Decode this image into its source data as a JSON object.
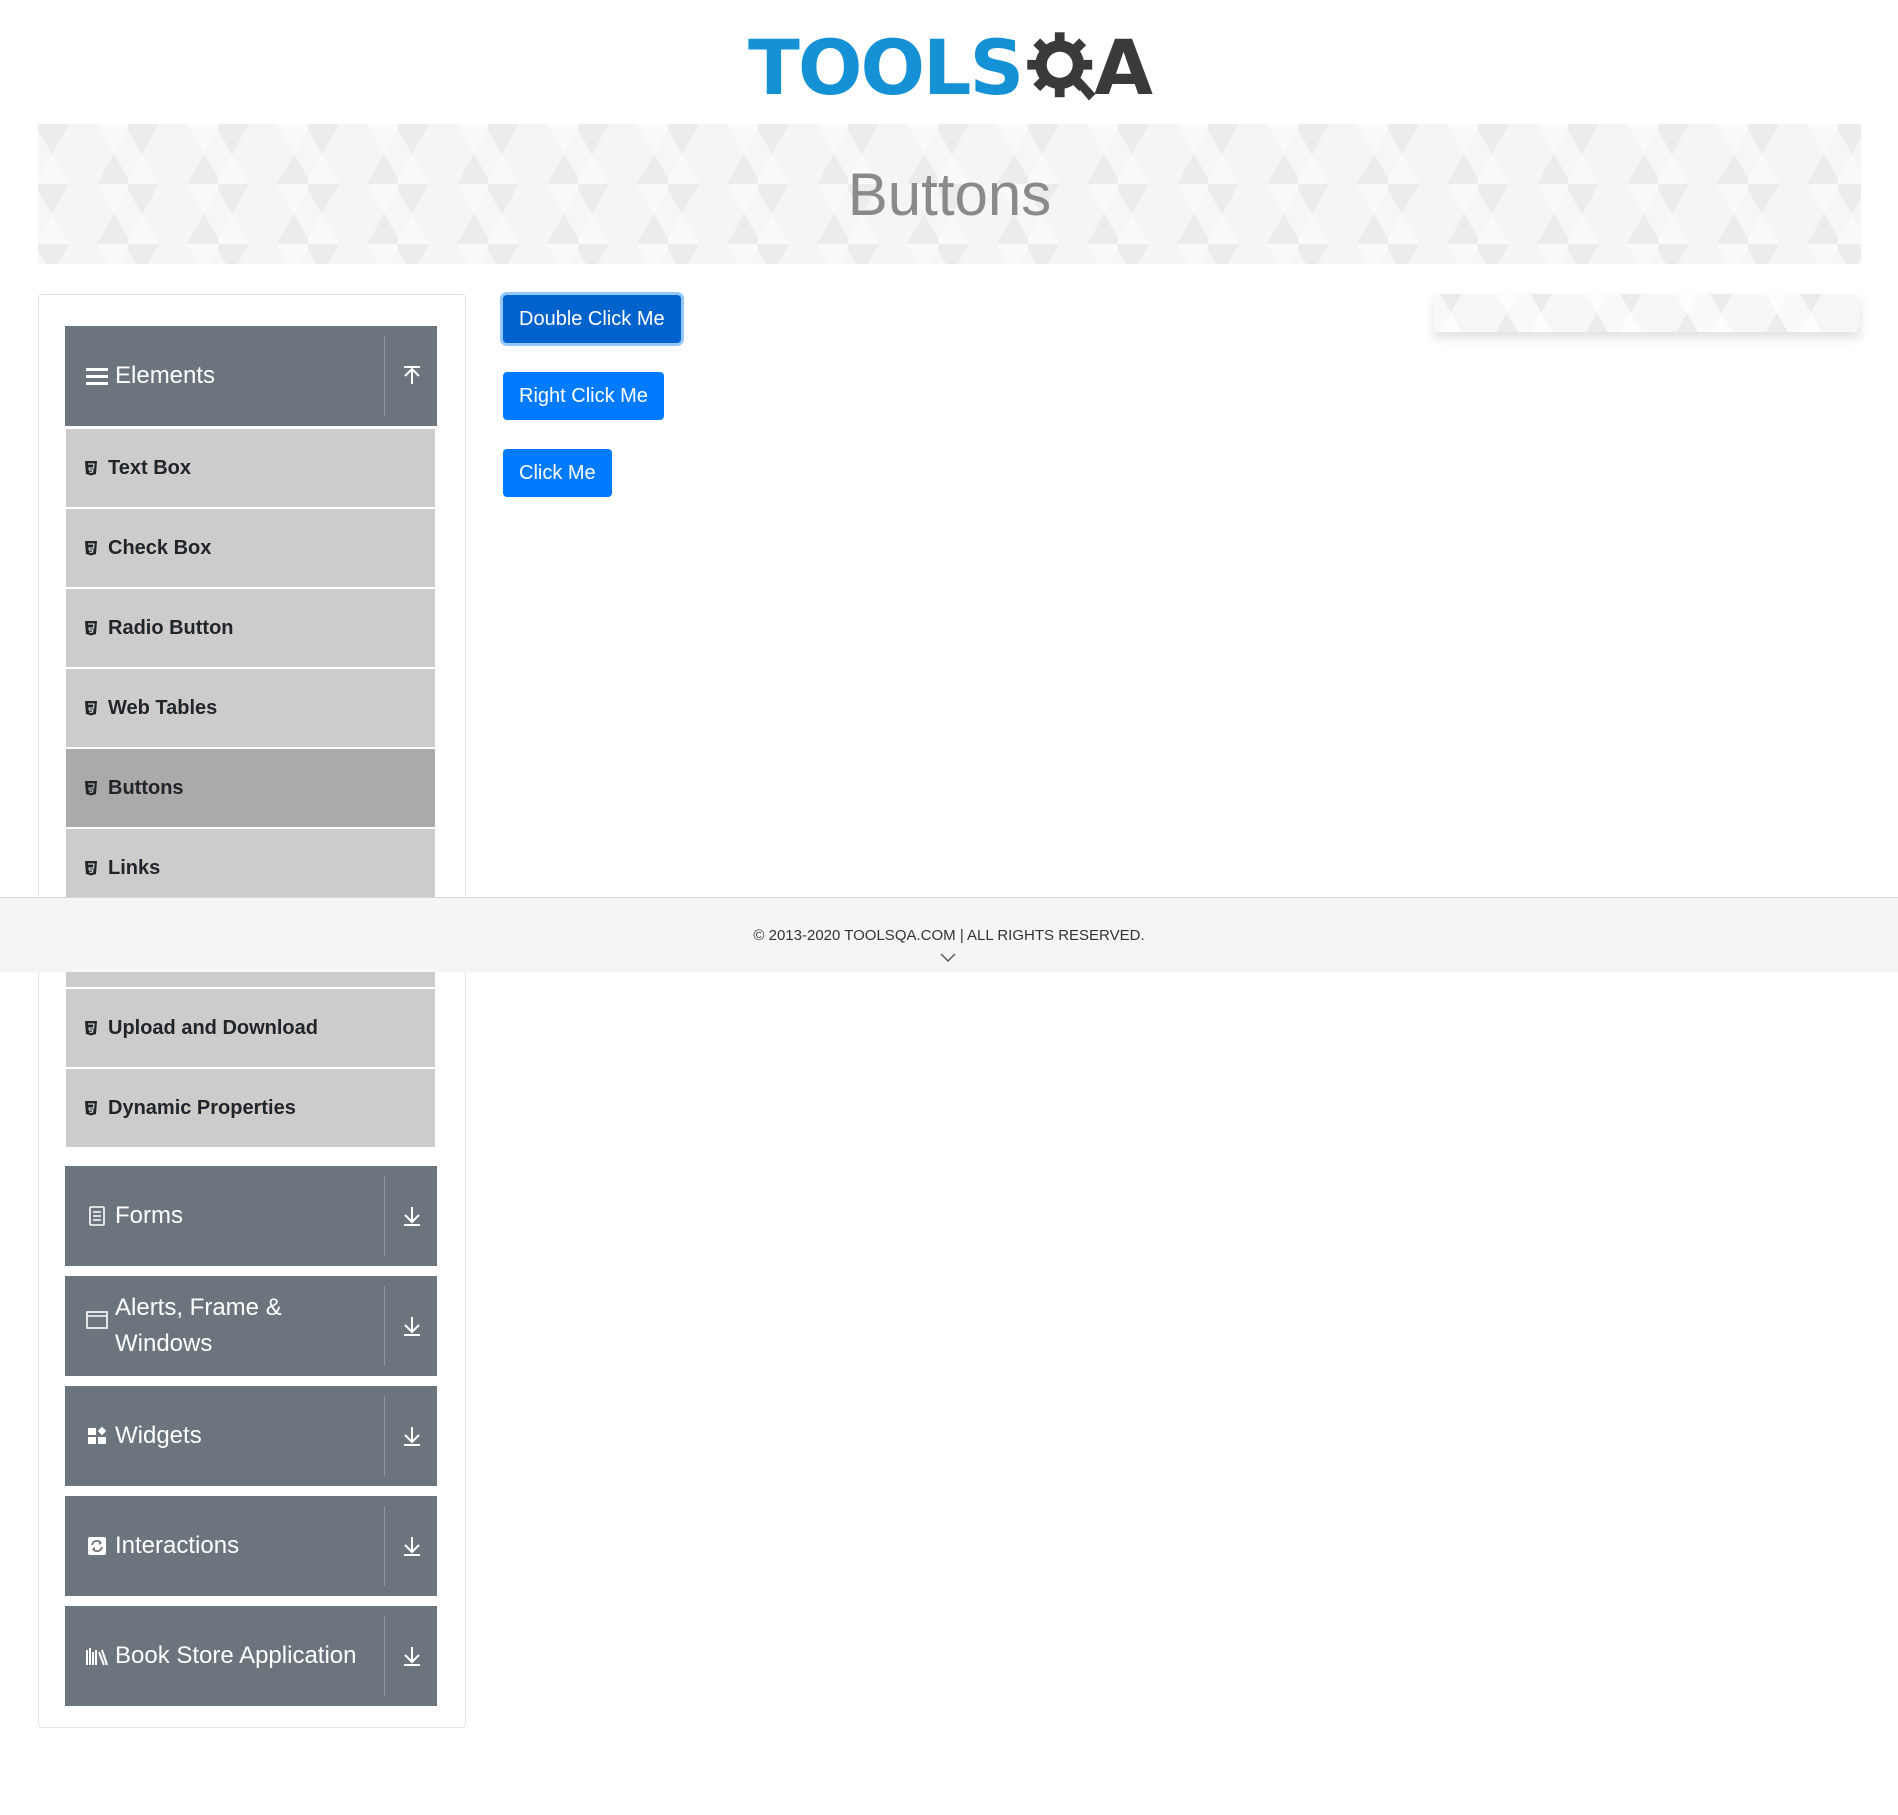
{
  "logo": {
    "text_part": "TOOLS",
    "gear_letter": "Q",
    "last_letter": "A"
  },
  "banner": {
    "title": "Buttons"
  },
  "sidebar": {
    "groups": [
      {
        "label": "Elements",
        "icon": "hamburger-icon",
        "state": "expanded"
      },
      {
        "label": "Forms",
        "icon": "document-icon",
        "state": "collapsed"
      },
      {
        "label": "Alerts, Frame & Windows",
        "icon": "window-icon",
        "state": "collapsed"
      },
      {
        "label": "Widgets",
        "icon": "widgets-icon",
        "state": "collapsed"
      },
      {
        "label": "Interactions",
        "icon": "interactions-icon",
        "state": "collapsed"
      },
      {
        "label": "Book Store Application",
        "icon": "books-icon",
        "state": "collapsed"
      }
    ],
    "elements_items": [
      {
        "label": "Text Box"
      },
      {
        "label": "Check Box"
      },
      {
        "label": "Radio Button"
      },
      {
        "label": "Web Tables"
      },
      {
        "label": "Buttons",
        "active": true
      },
      {
        "label": "Links"
      },
      {
        "label": "Upload and Download"
      },
      {
        "label": "Dynamic Properties"
      }
    ]
  },
  "buttons": {
    "double_click": "Double Click Me",
    "right_click": "Right Click Me",
    "click": "Click Me"
  },
  "footer": {
    "copyright": "© 2013-2020 TOOLSQA.COM | ALL RIGHTS RESERVED."
  },
  "colors": {
    "primary": "#007bff",
    "sidebar_group": "#6c757d",
    "menu_item": "#cccccc",
    "menu_item_active": "#aaaaaa",
    "logo_blue": "#1592d6"
  }
}
